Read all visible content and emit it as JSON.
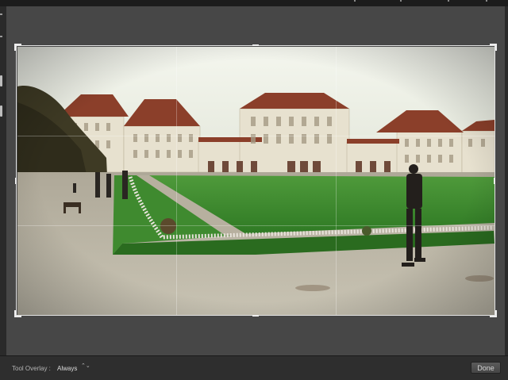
{
  "toolbar": {
    "tool_overlay_label": "Tool Overlay :",
    "tool_overlay_value": "Always",
    "tool_overlay_arrows": "⌃⌄",
    "done_label": "Done"
  },
  "colors": {
    "app_background": "#474747",
    "toolbar_background": "#2e2e2e",
    "crop_guides": "#ffffff"
  },
  "photo": {
    "subject": "palace-with-lawn-and-walkers"
  }
}
